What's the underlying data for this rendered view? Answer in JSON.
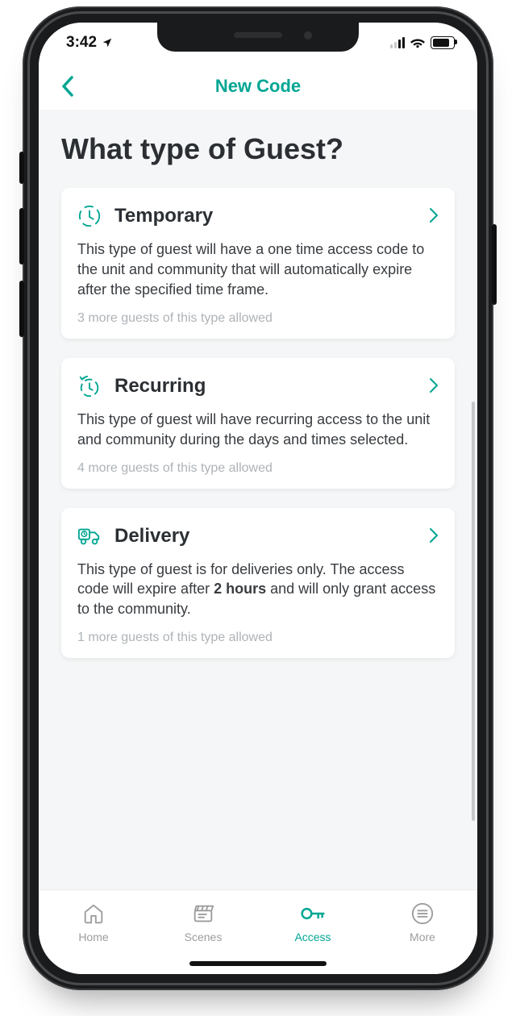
{
  "colors": {
    "accent": "#00a693"
  },
  "status": {
    "time": "3:42"
  },
  "header": {
    "title": "New Code"
  },
  "page": {
    "title": "What type of Guest?"
  },
  "cards": [
    {
      "title": "Temporary",
      "desc": "This type of guest will have a one time access code to the unit and community that will automatically expire after the specified time frame.",
      "allowance": "3 more guests of this type allowed"
    },
    {
      "title": "Recurring",
      "desc": "This type of guest will have recurring access to the unit and community during the days and times selected.",
      "allowance": "4 more guests of this type allowed"
    },
    {
      "title": "Delivery",
      "desc_pre": "This type of guest is for deliveries only. The access code will expire after ",
      "desc_bold": "2 hours",
      "desc_post": " and will only grant access to the community.",
      "allowance": "1 more guests of this type allowed"
    }
  ],
  "tabs": [
    {
      "label": "Home"
    },
    {
      "label": "Scenes"
    },
    {
      "label": "Access"
    },
    {
      "label": "More"
    }
  ]
}
